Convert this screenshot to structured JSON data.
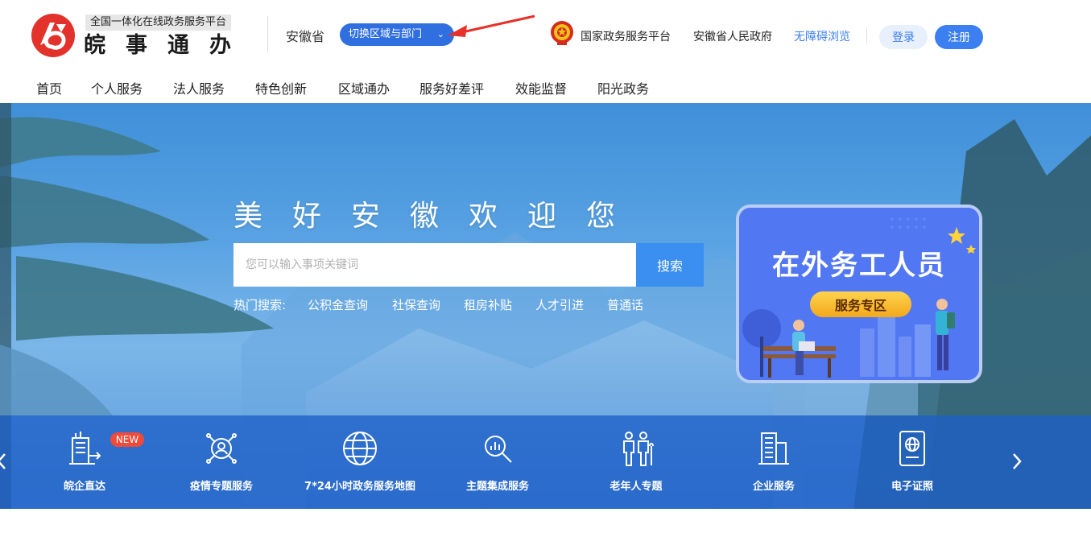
{
  "header": {
    "logo_subtitle": "全国一体化在线政务服务平台",
    "logo_title": "皖事通办",
    "region": "安徽省",
    "switch_label": "切换区域与部门",
    "links": {
      "national": "国家政务服务平台",
      "province": "安徽省人民政府",
      "accessible": "无障碍浏览"
    },
    "login_label": "登录",
    "register_label": "注册"
  },
  "nav": [
    "首页",
    "个人服务",
    "法人服务",
    "特色创新",
    "区域通办",
    "服务好差评",
    "效能监督",
    "阳光政务"
  ],
  "banner": {
    "welcome": "美好安徽欢迎您",
    "search_placeholder": "您可以输入事项关键词",
    "search_button": "搜索",
    "hot_label": "热门搜索:",
    "hot_items": [
      "公积金查询",
      "社保查询",
      "租房补贴",
      "人才引进",
      "普通话"
    ]
  },
  "promo": {
    "title": "在外务工人员",
    "button": "服务专区"
  },
  "services": [
    {
      "label": "皖企直达",
      "icon": "building-arrow-icon"
    },
    {
      "label": "疫情专题服务",
      "icon": "epidemic-icon"
    },
    {
      "label": "7*24小时政务服务地图",
      "icon": "globe-icon"
    },
    {
      "label": "主题集成服务",
      "icon": "chart-magnifier-icon"
    },
    {
      "label": "老年人专题",
      "icon": "elderly-icon"
    },
    {
      "label": "企业服务",
      "icon": "office-building-icon"
    },
    {
      "label": "电子证照",
      "icon": "passport-icon"
    }
  ],
  "new_badge": "NEW",
  "colors": {
    "primary": "#3b7ff0",
    "switch": "#2f6fe0",
    "logo_red": "#e2322b",
    "badge": "#ef4a3a",
    "promo_bg": "#4f73f2"
  }
}
